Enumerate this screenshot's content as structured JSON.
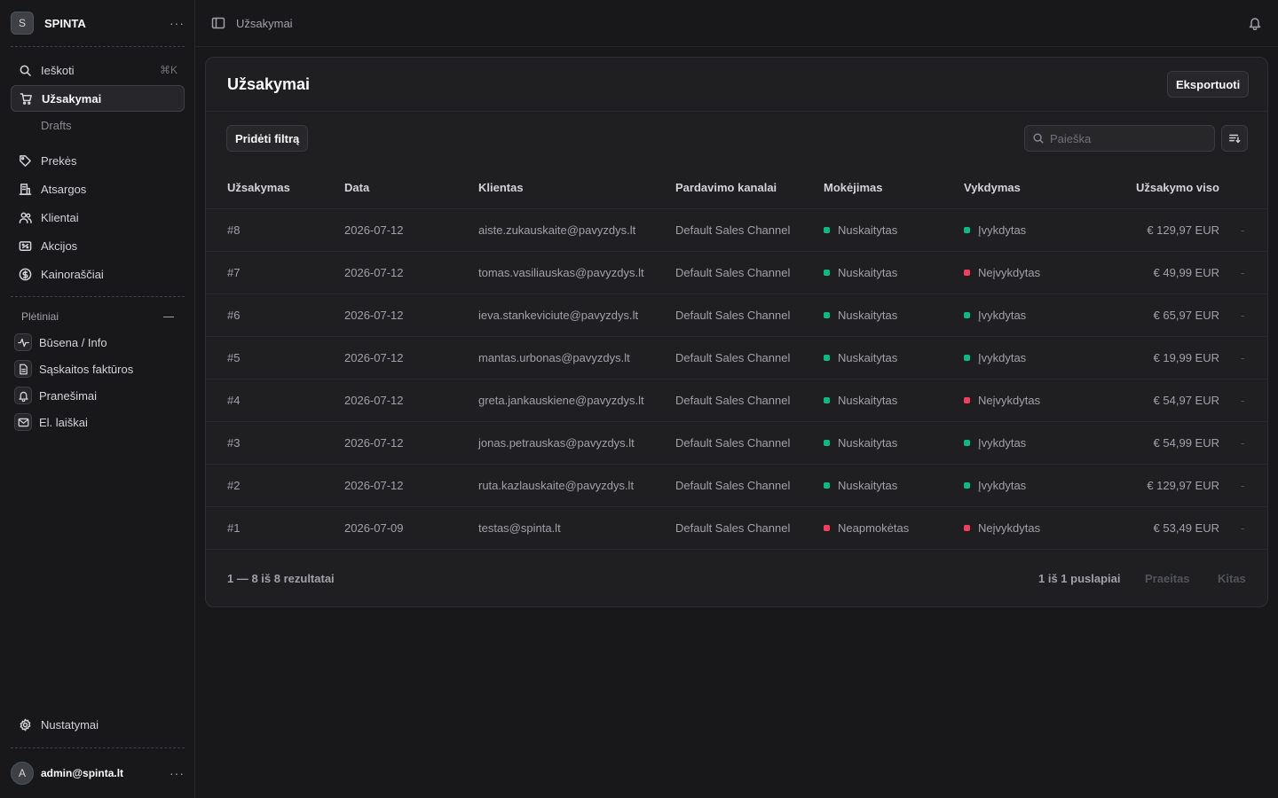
{
  "store": {
    "initial": "S",
    "name": "SPINTA"
  },
  "sidebar": {
    "search": {
      "label": "Ieškoti",
      "shortcut": "⌘K"
    },
    "items": [
      {
        "label": "Užsakymai",
        "icon": "cart-icon",
        "active": true
      },
      {
        "label": "Prekės",
        "icon": "tag-icon"
      },
      {
        "label": "Atsargos",
        "icon": "building-icon"
      },
      {
        "label": "Klientai",
        "icon": "users-icon"
      },
      {
        "label": "Akcijos",
        "icon": "receipt-icon"
      },
      {
        "label": "Kainoraščiai",
        "icon": "currency-icon"
      }
    ],
    "sub_item": "Drafts",
    "extensions_title": "Plėtiniai",
    "extensions": [
      {
        "label": "Būsena / Info",
        "icon": "pulse-icon"
      },
      {
        "label": "Sąskaitos faktūros",
        "icon": "document-icon"
      },
      {
        "label": "Pranešimai",
        "icon": "bell-icon"
      },
      {
        "label": "El. laiškai",
        "icon": "mail-icon"
      }
    ],
    "settings": "Nustatymai",
    "user": {
      "initial": "A",
      "email": "admin@spinta.lt"
    }
  },
  "topbar": {
    "breadcrumb": "Užsakymai"
  },
  "page": {
    "title": "Užsakymai",
    "export_label": "Eksportuoti",
    "filter_label": "Pridėti filtrą",
    "search_placeholder": "Paieška"
  },
  "table": {
    "columns": [
      "Užsakymas",
      "Data",
      "Klientas",
      "Pardavimo kanalai",
      "Mokėjimas",
      "Vykdymas",
      "Užsakymo viso"
    ],
    "rows": [
      {
        "id": "#8",
        "date": "2026-07-12",
        "customer": "aiste.zukauskaite@pavyzdys.lt",
        "channel": "Default Sales Channel",
        "payment": "Nuskaitytas",
        "payment_color": "#10b981",
        "fulfillment": "Įvykdytas",
        "fulfillment_color": "#10b981",
        "total": "€ 129,97 EUR"
      },
      {
        "id": "#7",
        "date": "2026-07-12",
        "customer": "tomas.vasiliauskas@pavyzdys.lt",
        "channel": "Default Sales Channel",
        "payment": "Nuskaitytas",
        "payment_color": "#10b981",
        "fulfillment": "Neįvykdytas",
        "fulfillment_color": "#f43f5e",
        "total": "€ 49,99 EUR"
      },
      {
        "id": "#6",
        "date": "2026-07-12",
        "customer": "ieva.stankeviciute@pavyzdys.lt",
        "channel": "Default Sales Channel",
        "payment": "Nuskaitytas",
        "payment_color": "#10b981",
        "fulfillment": "Įvykdytas",
        "fulfillment_color": "#10b981",
        "total": "€ 65,97 EUR"
      },
      {
        "id": "#5",
        "date": "2026-07-12",
        "customer": "mantas.urbonas@pavyzdys.lt",
        "channel": "Default Sales Channel",
        "payment": "Nuskaitytas",
        "payment_color": "#10b981",
        "fulfillment": "Įvykdytas",
        "fulfillment_color": "#10b981",
        "total": "€ 19,99 EUR"
      },
      {
        "id": "#4",
        "date": "2026-07-12",
        "customer": "greta.jankauskiene@pavyzdys.lt",
        "channel": "Default Sales Channel",
        "payment": "Nuskaitytas",
        "payment_color": "#10b981",
        "fulfillment": "Neįvykdytas",
        "fulfillment_color": "#f43f5e",
        "total": "€ 54,97 EUR"
      },
      {
        "id": "#3",
        "date": "2026-07-12",
        "customer": "jonas.petrauskas@pavyzdys.lt",
        "channel": "Default Sales Channel",
        "payment": "Nuskaitytas",
        "payment_color": "#10b981",
        "fulfillment": "Įvykdytas",
        "fulfillment_color": "#10b981",
        "total": "€ 54,99 EUR"
      },
      {
        "id": "#2",
        "date": "2026-07-12",
        "customer": "ruta.kazlauskaite@pavyzdys.lt",
        "channel": "Default Sales Channel",
        "payment": "Nuskaitytas",
        "payment_color": "#10b981",
        "fulfillment": "Įvykdytas",
        "fulfillment_color": "#10b981",
        "total": "€ 129,97 EUR"
      },
      {
        "id": "#1",
        "date": "2026-07-09",
        "customer": "testas@spinta.lt",
        "channel": "Default Sales Channel",
        "payment": "Neapmokėtas",
        "payment_color": "#f43f5e",
        "fulfillment": "Neįvykdytas",
        "fulfillment_color": "#f43f5e",
        "total": "€ 53,49 EUR"
      }
    ],
    "row_action": "-"
  },
  "pagination": {
    "results": "1 — 8 iš 8 rezultatai",
    "pages": "1 iš 1 puslapiai",
    "prev": "Praeitas",
    "next": "Kitas"
  }
}
